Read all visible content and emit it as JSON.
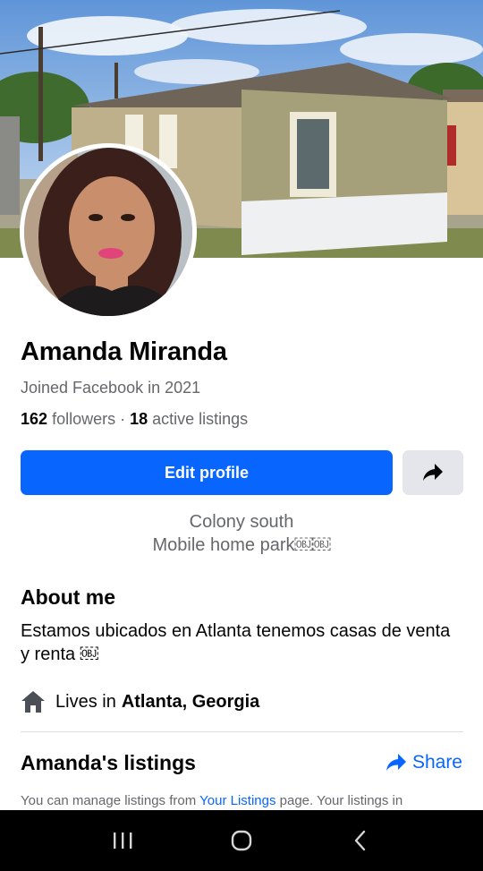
{
  "profile": {
    "name": "Amanda Miranda",
    "joined": "Joined Facebook in 2021",
    "followers_count": "162",
    "followers_label": "followers",
    "separator": " · ",
    "listings_count": "18",
    "listings_label": "active listings"
  },
  "actions": {
    "edit_profile_label": "Edit profile",
    "share_icon": "share-arrow-icon"
  },
  "bio": {
    "line1": "Colony south",
    "line2": "Mobile home park￼￼"
  },
  "about": {
    "title": "About me",
    "text": "Estamos ubicados en Atlanta tenemos casas de venta y renta ￼",
    "lives_prefix": "Lives in",
    "lives_location": "Atlanta, Georgia"
  },
  "listings": {
    "title": "Amanda's listings",
    "share_label": "Share",
    "note_prefix": "You can manage listings from ",
    "note_link": "Your Listings",
    "note_suffix": " page. Your listings in"
  },
  "colors": {
    "primary": "#0866ff",
    "secondary_text": "#65676b",
    "button_gray": "#e4e6eb"
  },
  "system_nav": {
    "recent_icon": "recent-apps-icon",
    "home_icon": "home-circle-icon",
    "back_icon": "back-chevron-icon"
  }
}
